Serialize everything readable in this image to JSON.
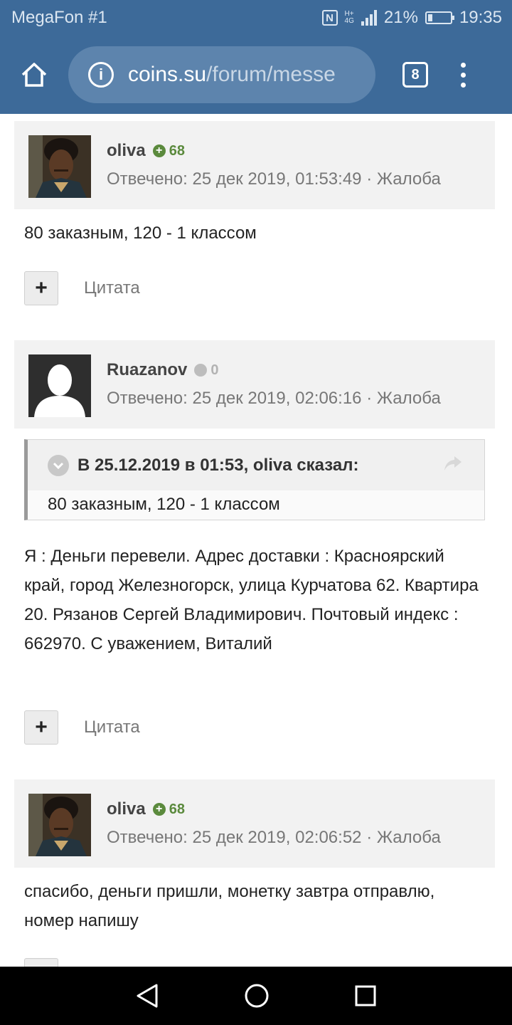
{
  "status_bar": {
    "carrier": "MegaFon #1",
    "network_top": "H+",
    "network_bottom": "4G",
    "battery": "21%",
    "battery_level": 0.21,
    "time": "19:35"
  },
  "browser": {
    "url_domain": "coins.su",
    "url_path": "/forum/messe",
    "tab_count": "8"
  },
  "posts": [
    {
      "author": "oliva",
      "reputation": "68",
      "reputation_type": "positive",
      "answered": "Отвечено: 25 дек 2019, 01:53:49",
      "separator": "·",
      "report": "Жалоба",
      "body": "80 заказным, 120 - 1 классом",
      "quote_label": "Цитата"
    },
    {
      "author": "Ruazanov",
      "reputation": "0",
      "reputation_type": "neutral",
      "answered": "Отвечено: 25 дек 2019, 02:06:16",
      "separator": "·",
      "report": "Жалоба",
      "quote": {
        "title": "В 25.12.2019 в 01:53, oliva сказал:",
        "text": "80 заказным, 120 - 1 классом"
      },
      "body": "Я : Деньги перевели. Адрес доставки : Красноярский край, город Железногорск, улица Курчатова 62. Квартира 20. Рязанов Сергей Владимирович. Почтовый индекс : 662970. С уважением, Виталий",
      "quote_label": "Цитата"
    },
    {
      "author": "oliva",
      "reputation": "68",
      "reputation_type": "positive",
      "answered": "Отвечено: 25 дек 2019, 02:06:52",
      "separator": "·",
      "report": "Жалоба",
      "body": "спасибо, деньги пришли, монетку завтра отправлю, номер напишу"
    }
  ],
  "colors": {
    "toolbar": "#3d6a99",
    "url_bar": "#5d84ad",
    "post_header": "#f2f2f2",
    "rep_positive": "#5b8a3d",
    "rep_neutral": "#bdbdbd"
  }
}
